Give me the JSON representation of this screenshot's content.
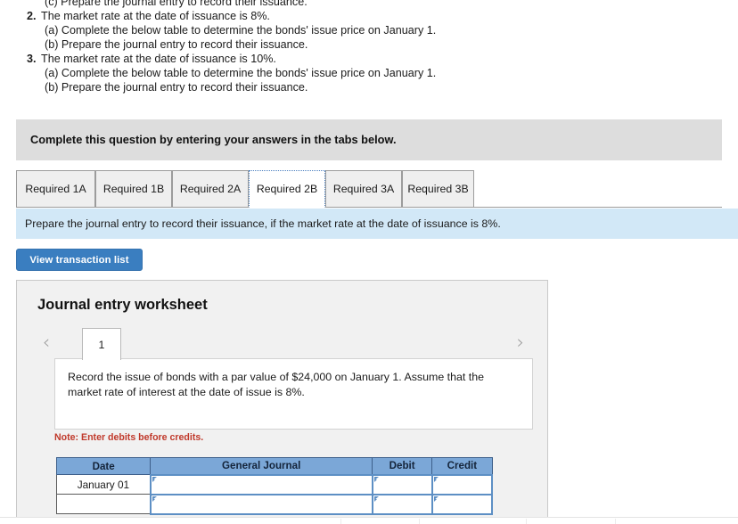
{
  "requirements": {
    "clipped_top_line": "(c) Prepare the journal entry to record their issuance.",
    "items": [
      {
        "num": "2.",
        "text": "The market rate at the date of issuance is 8%.",
        "subs": [
          "(a) Complete the below table to determine the bonds' issue price on January 1.",
          "(b) Prepare the journal entry to record their issuance."
        ]
      },
      {
        "num": "3.",
        "text": "The market rate at the date of issuance is 10%.",
        "subs": [
          "(a) Complete the below table to determine the bonds' issue price on January 1.",
          "(b) Prepare the journal entry to record their issuance."
        ]
      }
    ]
  },
  "gray_banner": {
    "text": "Complete this question by entering your answers in the tabs below."
  },
  "tabs": {
    "items": [
      {
        "label": "Required 1A",
        "active": false
      },
      {
        "label": "Required 1B",
        "active": false
      },
      {
        "label": "Required 2A",
        "active": false
      },
      {
        "label": "Required 2B",
        "active": true
      },
      {
        "label": "Required 3A",
        "active": false
      },
      {
        "label": "Required 3B",
        "active": false
      }
    ]
  },
  "info_bar": {
    "text": "Prepare the journal entry to record their issuance, if the market rate at the date of issuance is 8%."
  },
  "buttons": {
    "view_transaction_list": "View transaction list"
  },
  "worksheet": {
    "title": "Journal entry worksheet",
    "pager": {
      "prev_icon": "chevron-left-icon",
      "next_icon": "chevron-right-icon",
      "current_page": "1"
    },
    "description": "Record the issue of bonds with a par value of $24,000 on January 1. Assume that the market rate of interest at the date of issue is 8%.",
    "note": "Note: Enter debits before credits.",
    "table": {
      "headers": [
        "Date",
        "General Journal",
        "Debit",
        "Credit"
      ],
      "rows": [
        {
          "date": "January 01",
          "general_journal": "",
          "debit": "",
          "credit": ""
        },
        {
          "date": "",
          "general_journal": "",
          "debit": "",
          "credit": ""
        }
      ]
    }
  },
  "colors": {
    "accent_blue": "#3a7ec0",
    "info_bar_blue": "#d2e8f7",
    "table_header_blue": "#7ba7d7",
    "input_border_blue": "#5d8fc4",
    "note_red": "#c0392b",
    "banner_gray": "#dddddd",
    "panel_gray": "#f1f1f1"
  }
}
